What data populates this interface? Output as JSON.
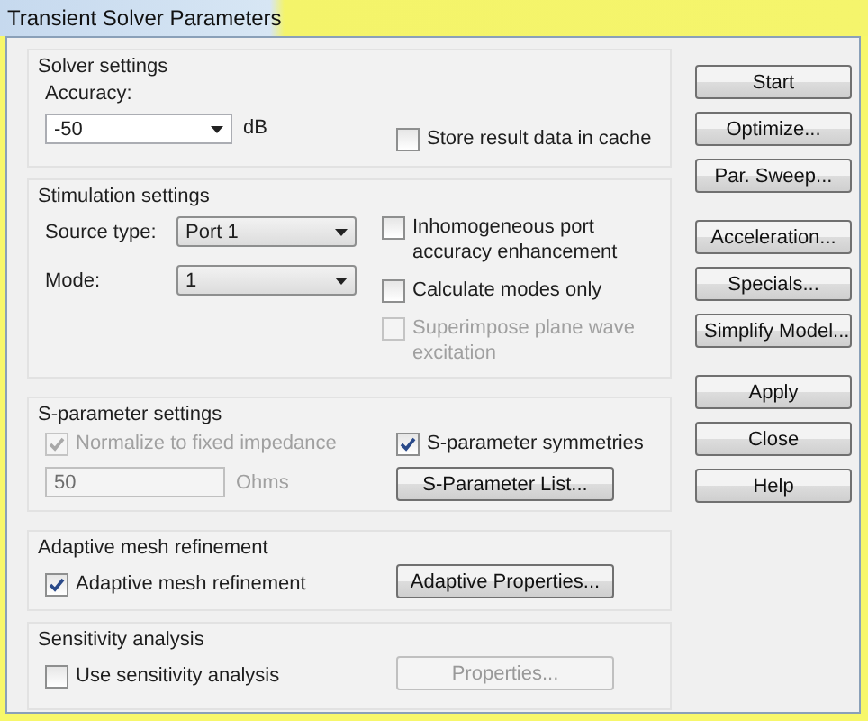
{
  "window": {
    "title": "Transient Solver Parameters"
  },
  "solver_settings": {
    "title": "Solver settings",
    "accuracy_label": "Accuracy:",
    "accuracy": {
      "value": "-50",
      "unit": "dB"
    },
    "store_cache": {
      "label": "Store result data in cache",
      "checked": false,
      "disabled": false
    }
  },
  "stimulation_settings": {
    "title": "Stimulation settings",
    "source_type": {
      "label": "Source type:",
      "value": "Port 1"
    },
    "mode": {
      "label": "Mode:",
      "value": "1"
    },
    "options": [
      {
        "label": "Inhomogeneous port accuracy enhancement",
        "checked": false,
        "disabled": false
      },
      {
        "label": "Calculate modes only",
        "checked": false,
        "disabled": false
      },
      {
        "label": "Superimpose plane wave excitation",
        "checked": false,
        "disabled": true
      }
    ]
  },
  "s_parameter_settings": {
    "title": "S-parameter settings",
    "normalize": {
      "label": "Normalize to fixed impedance",
      "checked": true,
      "disabled": true
    },
    "impedance": {
      "value": "50",
      "unit": "Ohms",
      "disabled": true
    },
    "symmetries": {
      "label": "S-parameter symmetries",
      "checked": true,
      "disabled": false
    },
    "list_button": {
      "label": "S-Parameter List...",
      "disabled": false
    }
  },
  "adaptive_mesh_refinement": {
    "title": "Adaptive mesh refinement",
    "option": {
      "label": "Adaptive mesh refinement",
      "checked": true,
      "disabled": false
    },
    "button": {
      "label": "Adaptive Properties...",
      "disabled": false
    }
  },
  "sensitivity_analysis": {
    "title": "Sensitivity analysis",
    "option": {
      "label": "Use sensitivity analysis",
      "checked": false,
      "disabled": false
    },
    "button": {
      "label": "Properties...",
      "disabled": true
    }
  },
  "button_groups": [
    [
      {
        "label": "Start",
        "disabled": false
      },
      {
        "label": "Optimize...",
        "disabled": false
      },
      {
        "label": "Par. Sweep...",
        "disabled": false
      }
    ],
    [
      {
        "label": "Acceleration...",
        "disabled": false
      },
      {
        "label": "Specials...",
        "disabled": false
      },
      {
        "label": "Simplify Model...",
        "disabled": false
      }
    ],
    [
      {
        "label": "Apply",
        "disabled": false
      },
      {
        "label": "Close",
        "disabled": false
      },
      {
        "label": "Help",
        "disabled": false
      }
    ]
  ]
}
